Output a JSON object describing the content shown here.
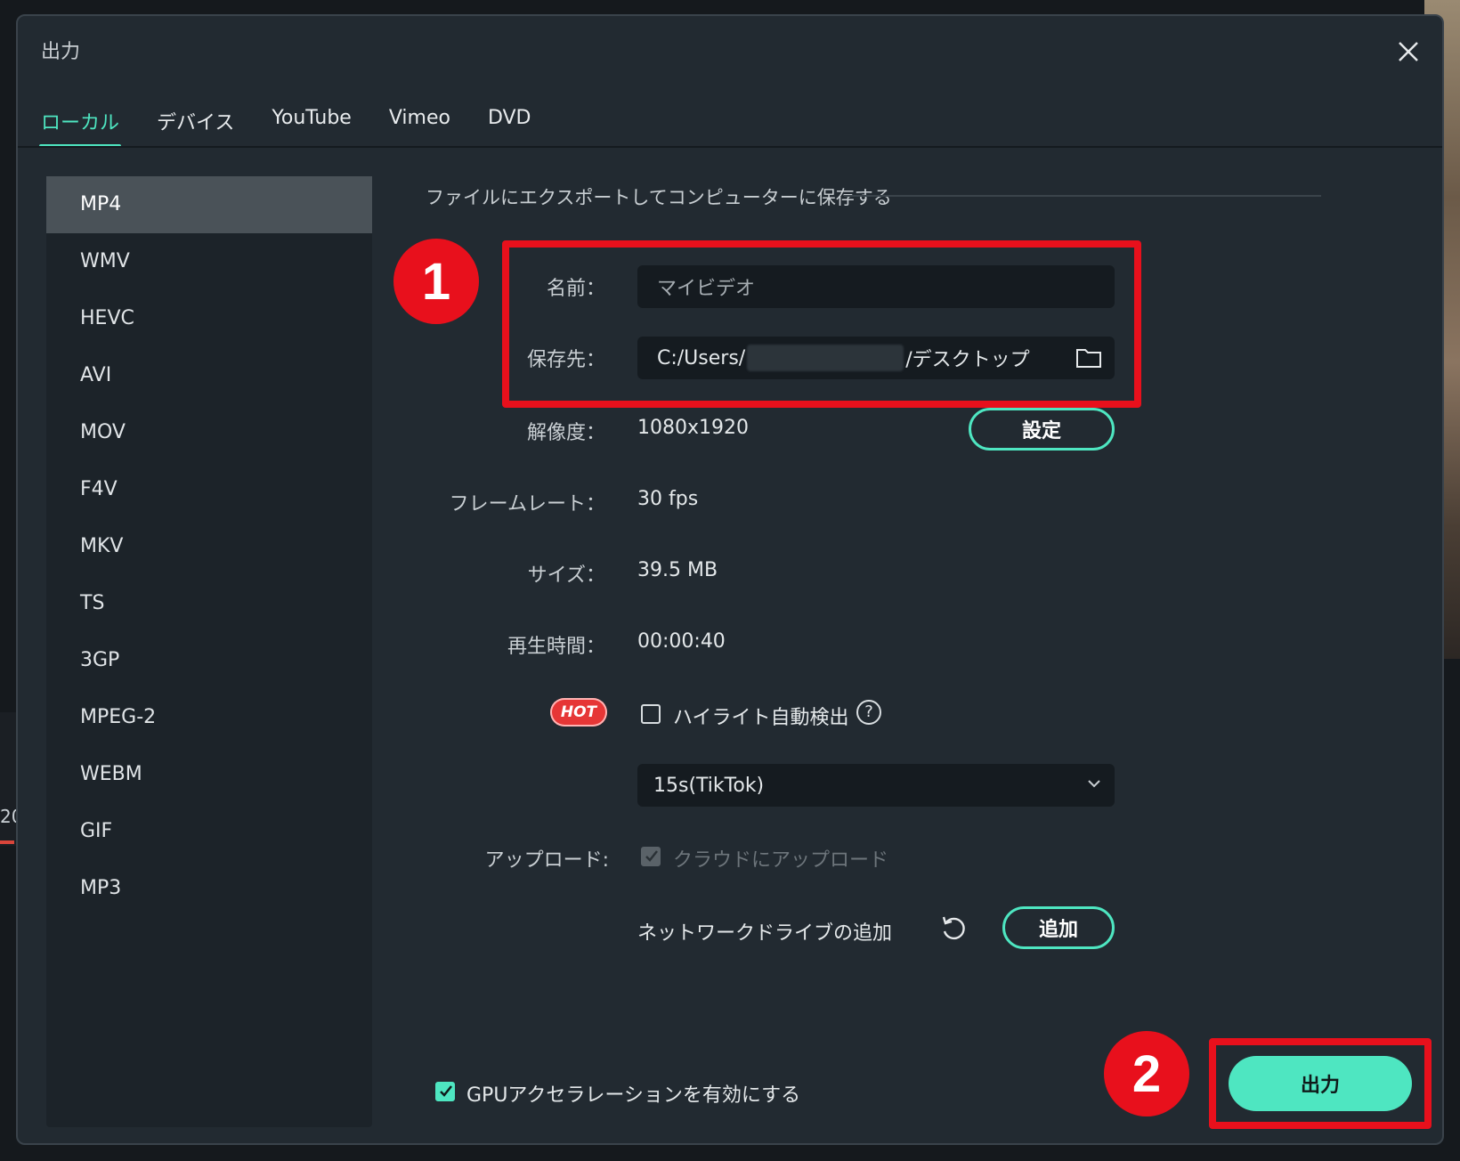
{
  "dialog": {
    "title": "出力",
    "tabs": [
      "ローカル",
      "デバイス",
      "YouTube",
      "Vimeo",
      "DVD"
    ]
  },
  "formats": [
    "MP4",
    "WMV",
    "HEVC",
    "AVI",
    "MOV",
    "F4V",
    "MKV",
    "TS",
    "3GP",
    "MPEG-2",
    "WEBM",
    "GIF",
    "MP3"
  ],
  "form": {
    "section_title": "ファイルにエクスポートしてコンピューターに保存する",
    "name_label": "名前：",
    "name_value": "マイビデオ",
    "path_label": "保存先：",
    "path_prefix": "C:/Users/",
    "path_suffix": "/デスクトップ",
    "resolution_label": "解像度：",
    "resolution_value": "1080x1920",
    "settings_button": "設定",
    "framerate_label": "フレームレート：",
    "framerate_value": "30 fps",
    "size_label": "サイズ：",
    "size_value": "39.5 MB",
    "duration_label": "再生時間：",
    "duration_value": "00:00:40",
    "hot_badge": "HOT",
    "highlight_label": "ハイライト自動検出",
    "help_glyph": "?",
    "highlight_option": "15s(TikTok)",
    "upload_label": "アップロード:",
    "upload_cloud": "クラウドにアップロード",
    "network_drive_label": "ネットワークドライブの追加",
    "add_button": "追加",
    "gpu_label": "GPUアクセラレーションを有効にする",
    "output_button": "出力"
  },
  "annotations": {
    "badge1": "1",
    "badge2": "2"
  },
  "background": {
    "timeline_number": "20"
  },
  "colors": {
    "accent": "#4ee6c1",
    "annotation": "#e8101c",
    "panel": "#222a31"
  }
}
